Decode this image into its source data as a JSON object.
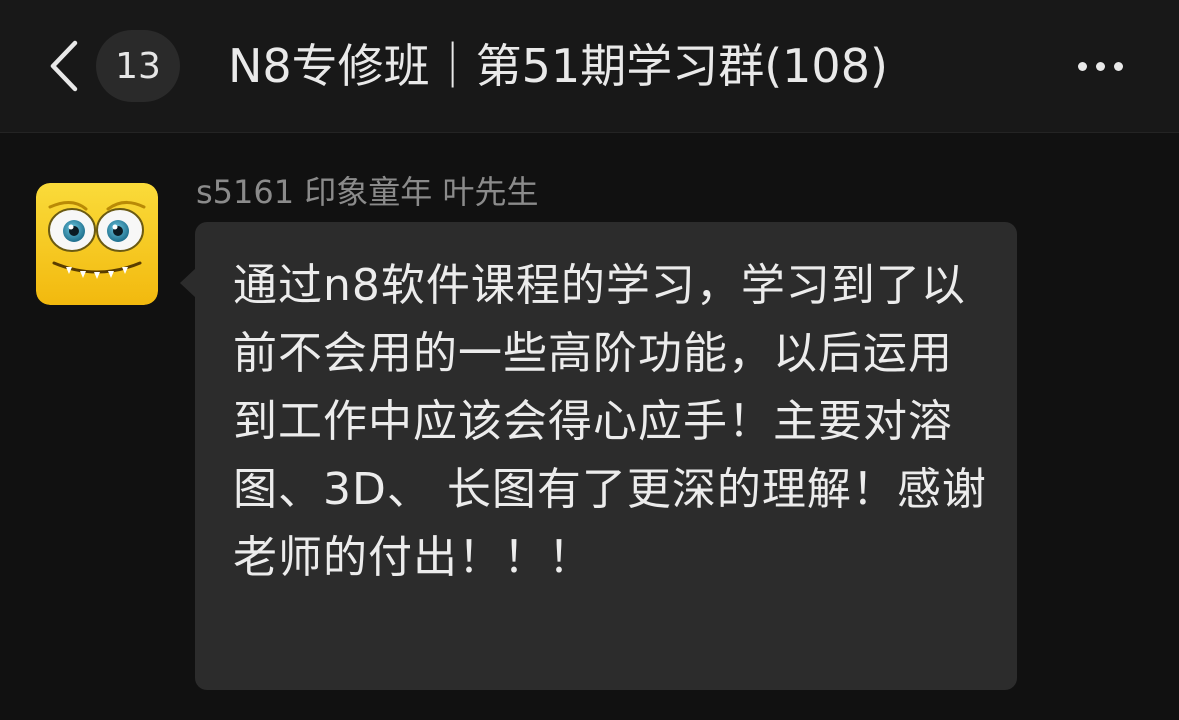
{
  "header": {
    "back_icon": "chevron-left-icon",
    "unread_count": "13",
    "title": "N8专修班｜第51期学习群(108)",
    "more_icon": "more-horizontal-icon"
  },
  "message": {
    "avatar_icon": "yellow-monster-avatar",
    "sender": "s5161 印象童年 叶先生",
    "text": "通过n8软件课程的学习，学习到了以前不会用的一些高阶功能，以后运用到工作中应该会得心应手！主要对溶图、3D、 长图有了更深的理解！感谢老师的付出！！！"
  },
  "colors": {
    "background": "#111111",
    "header_background": "#181818",
    "bubble": "#2c2c2c",
    "avatar_yellow": "#f7cc1c"
  }
}
